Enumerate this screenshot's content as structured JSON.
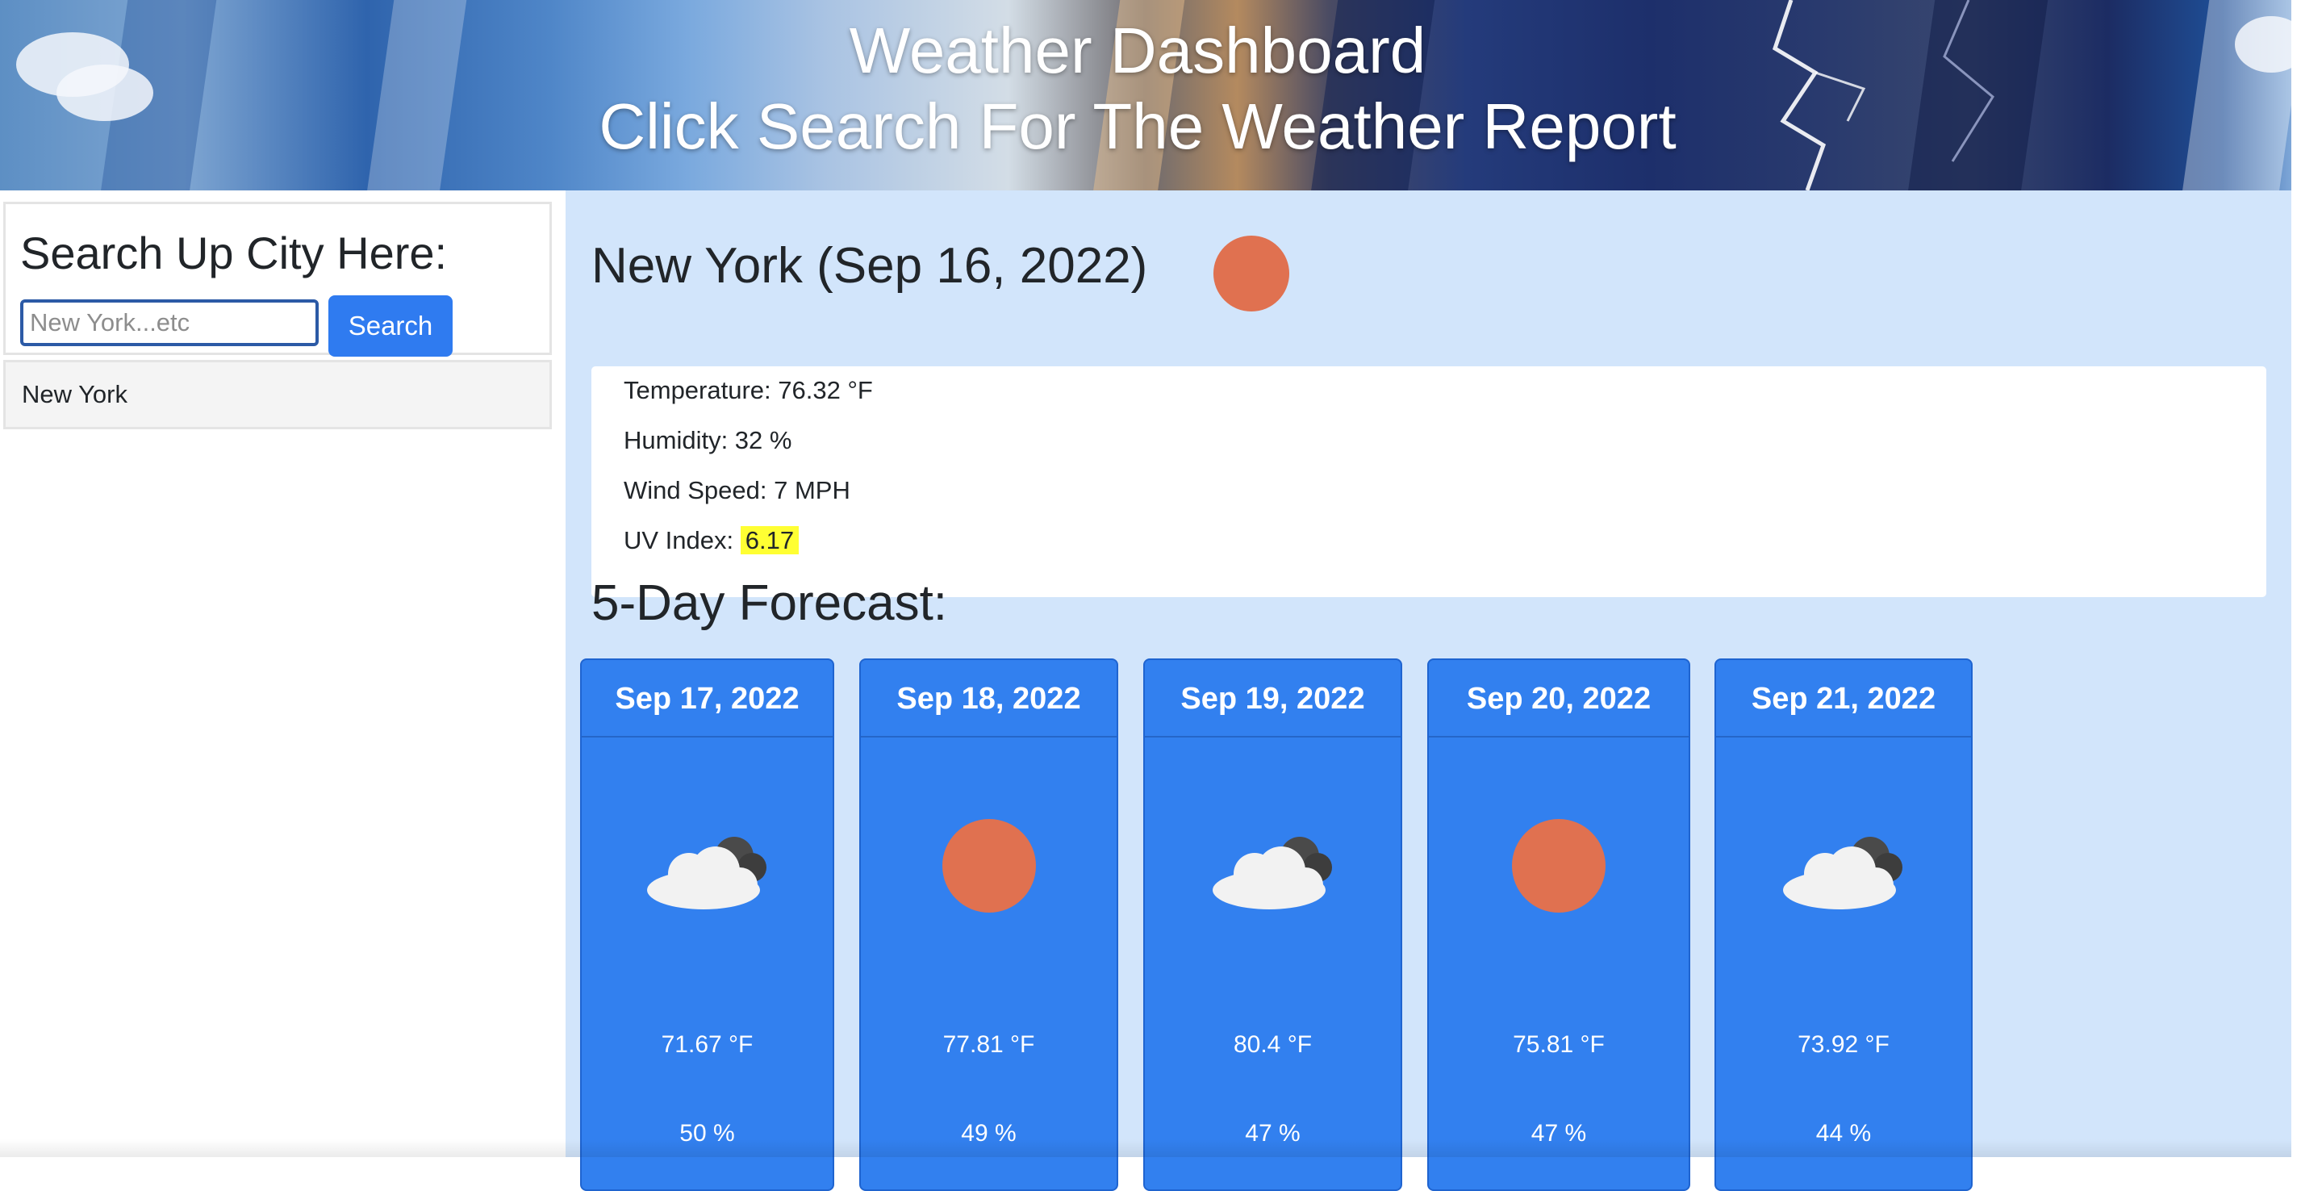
{
  "header": {
    "title": "Weather Dashboard",
    "subtitle": "Click Search For The Weather Report"
  },
  "sidebar": {
    "search_title": "Search Up City Here:",
    "search_placeholder": "New York...etc",
    "search_button": "Search",
    "history": [
      "New York"
    ]
  },
  "current": {
    "city_date": "New York (Sep 16, 2022)",
    "icon": "sun-icon",
    "temperature_label": "Temperature: 76.32 °F",
    "humidity_label": "Humidity: 32 %",
    "wind_label": "Wind Speed: 7 MPH",
    "uv_label": "UV Index:",
    "uv_value": "6.17"
  },
  "forecast": {
    "title": "5-Day Forecast:",
    "days": [
      {
        "date": "Sep 17, 2022",
        "icon": "cloud-icon",
        "temp": "71.67 °F",
        "humidity": "50 %"
      },
      {
        "date": "Sep 18, 2022",
        "icon": "sun-icon",
        "temp": "77.81 °F",
        "humidity": "49 %"
      },
      {
        "date": "Sep 19, 2022",
        "icon": "cloud-icon",
        "temp": "80.4 °F",
        "humidity": "47 %"
      },
      {
        "date": "Sep 20, 2022",
        "icon": "sun-icon",
        "temp": "75.81 °F",
        "humidity": "47 %"
      },
      {
        "date": "Sep 21, 2022",
        "icon": "cloud-icon",
        "temp": "73.92 °F",
        "humidity": "44 %"
      }
    ]
  },
  "colors": {
    "accent": "#3280ef",
    "main_background": "#d2e5fb",
    "sun": "#e07150",
    "uv_highlight": "#ffff33"
  }
}
